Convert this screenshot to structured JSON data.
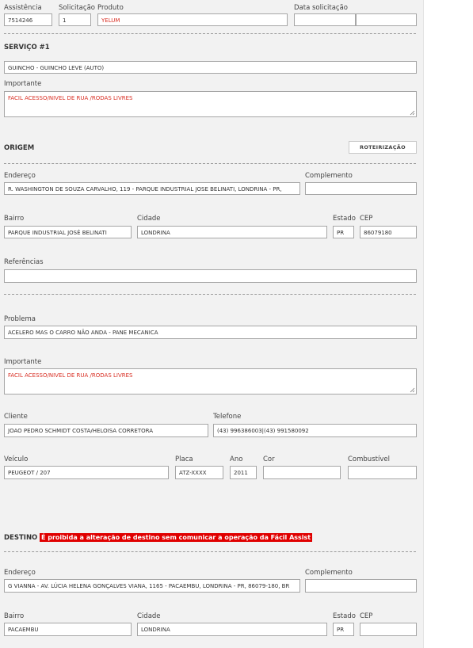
{
  "top": {
    "assistencia": {
      "label": "Assistência",
      "value": "7514246"
    },
    "solicitacao": {
      "label": "Solicitação",
      "value": "1"
    },
    "produto": {
      "label": "Produto",
      "value": "YELUM"
    },
    "data_solicitacao": {
      "label": "Data solicitação",
      "value": ""
    }
  },
  "servico": {
    "title": "SERVIÇO #1",
    "tipo": "GUINCHO - GUINCHO LEVE (AUTO)",
    "importante_label": "Importante",
    "importante_value": "FACIL ACESSO/NIVEL DE RUA /RODAS LIVRES"
  },
  "origem": {
    "title": "ORIGEM",
    "roteirizacao_label": "ROTEIRIZAÇÃO",
    "endereco_label": "Endereço",
    "endereco_value": "R. WASHINGTON DE SOUZA CARVALHO, 119 - PARQUE INDUSTRIAL JOSE BELINATI, LONDRINA - PR,",
    "complemento_label": "Complemento",
    "complemento_value": "",
    "bairro_label": "Bairro",
    "bairro_value": "PARQUE INDUSTRIAL JOSÉ BELINATI",
    "cidade_label": "Cidade",
    "cidade_value": "LONDRINA",
    "estado_label": "Estado",
    "estado_value": "PR",
    "cep_label": "CEP",
    "cep_value": "86079180",
    "referencias_label": "Referências",
    "referencias_value": ""
  },
  "problema": {
    "label": "Problema",
    "value": "ACELERO MAS O CARRO NÃO ANDA - PANE MECANICA",
    "importante_label": "Importante",
    "importante_value": "FACIL ACESSO/NIVEL DE RUA /RODAS LIVRES"
  },
  "cliente": {
    "label": "Cliente",
    "value": "JOAO PEDRO SCHMIDT COSTA/HELOISA CORRETORA",
    "telefone_label": "Telefone",
    "telefone_value": "(43) 996386003|(43) 991580092"
  },
  "veiculo": {
    "label": "Veículo",
    "value": "PEUGEOT / 207",
    "placa_label": "Placa",
    "placa_value": "ATZ-XXXX",
    "ano_label": "Ano",
    "ano_value": "2011",
    "cor_label": "Cor",
    "cor_value": "",
    "combustivel_label": "Combustível",
    "combustivel_value": ""
  },
  "destino": {
    "title": "DESTINO",
    "warning": "É proibida a alteração de destino sem comunicar a operação da Fácil Assist",
    "endereco_label": "Endereço",
    "endereco_value": "G VIANNA - AV. LÚCIA HELENA GONÇALVES VIANA, 1165 - PACAEMBU, LONDRINA - PR, 86079-180, BR",
    "complemento_label": "Complemento",
    "complemento_value": "",
    "bairro_label": "Bairro",
    "bairro_value": "PACAEMBU",
    "cidade_label": "Cidade",
    "cidade_value": "LONDRINA",
    "estado_label": "Estado",
    "estado_value": "PR",
    "cep_label": "CEP",
    "cep_value": ""
  },
  "colors": {
    "panel": "#f2f2f2",
    "red_text": "#d93025",
    "warning_bg": "#e00000"
  }
}
